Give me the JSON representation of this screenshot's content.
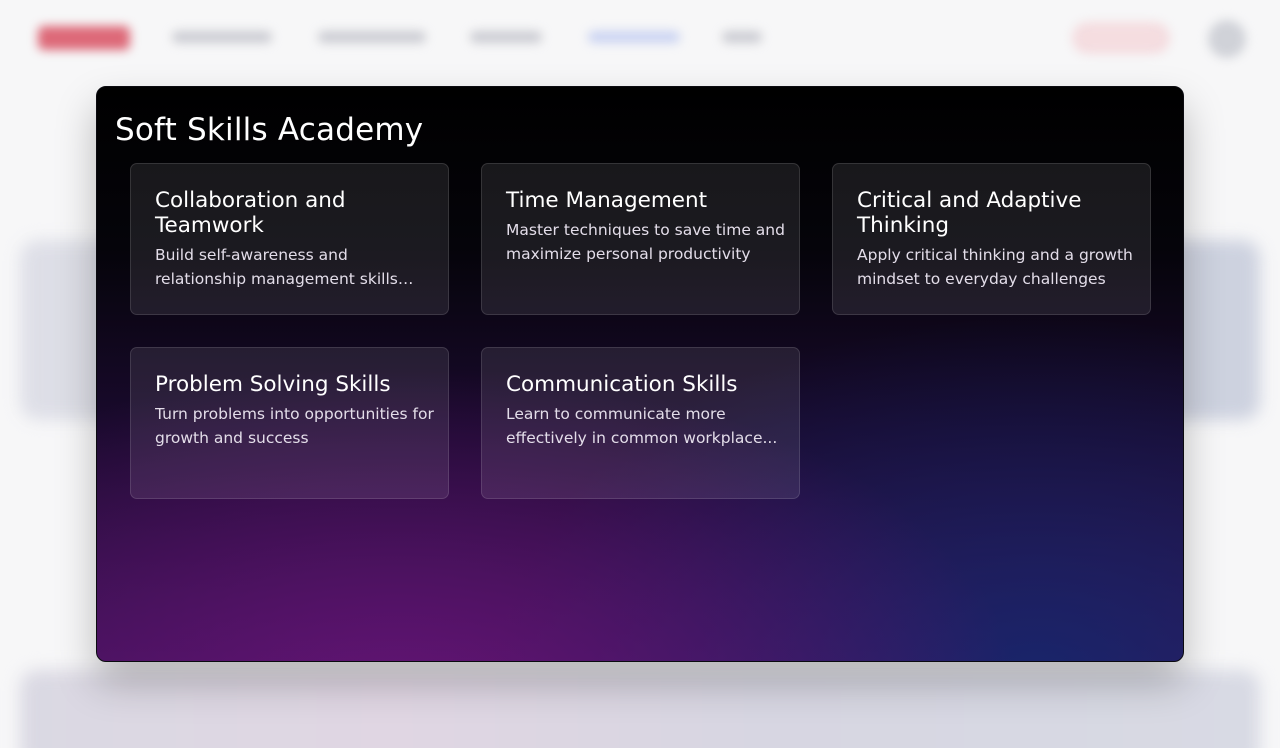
{
  "modal": {
    "title": "Soft Skills Academy",
    "courses": [
      {
        "title": "Collaboration and Teamwork",
        "description": "Build self-awareness and relationship management skills for..."
      },
      {
        "title": "Time Management",
        "description": "Master techniques to save time and maximize personal productivity"
      },
      {
        "title": "Critical and Adaptive Thinking",
        "description": "Apply critical thinking and a growth mindset to everyday challenges"
      },
      {
        "title": "Problem Solving Skills",
        "description": "Turn problems into opportunities for growth and success"
      },
      {
        "title": "Communication Skills",
        "description": "Learn to communicate more effectively in common workplace..."
      }
    ]
  },
  "colors": {
    "modal_top": "#000000",
    "modal_purple": "#5a1670",
    "modal_blue": "#12286e",
    "card_text": "#ffffff"
  }
}
